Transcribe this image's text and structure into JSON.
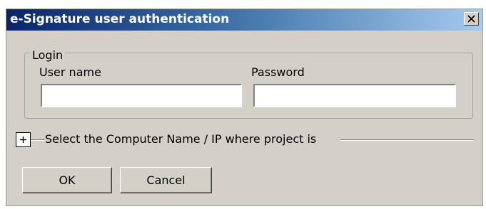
{
  "dialog": {
    "title": "e-Signature user authentication",
    "close_label": "X",
    "login_group": {
      "legend": "Login",
      "username_label": "User name",
      "username_value": "",
      "password_label": "Password",
      "password_value": ""
    },
    "project_section": {
      "expand_symbol": "+",
      "label": "Select the Computer Name / IP where project is"
    },
    "buttons": {
      "ok": "OK",
      "cancel": "Cancel"
    }
  },
  "colors": {
    "dialog_bg": "#d4d0c8",
    "title_start": "#0a246a",
    "title_end": "#a6caf0",
    "title_text": "#ffffff"
  },
  "icons": {
    "close": "close-icon",
    "expand": "plus-icon"
  }
}
